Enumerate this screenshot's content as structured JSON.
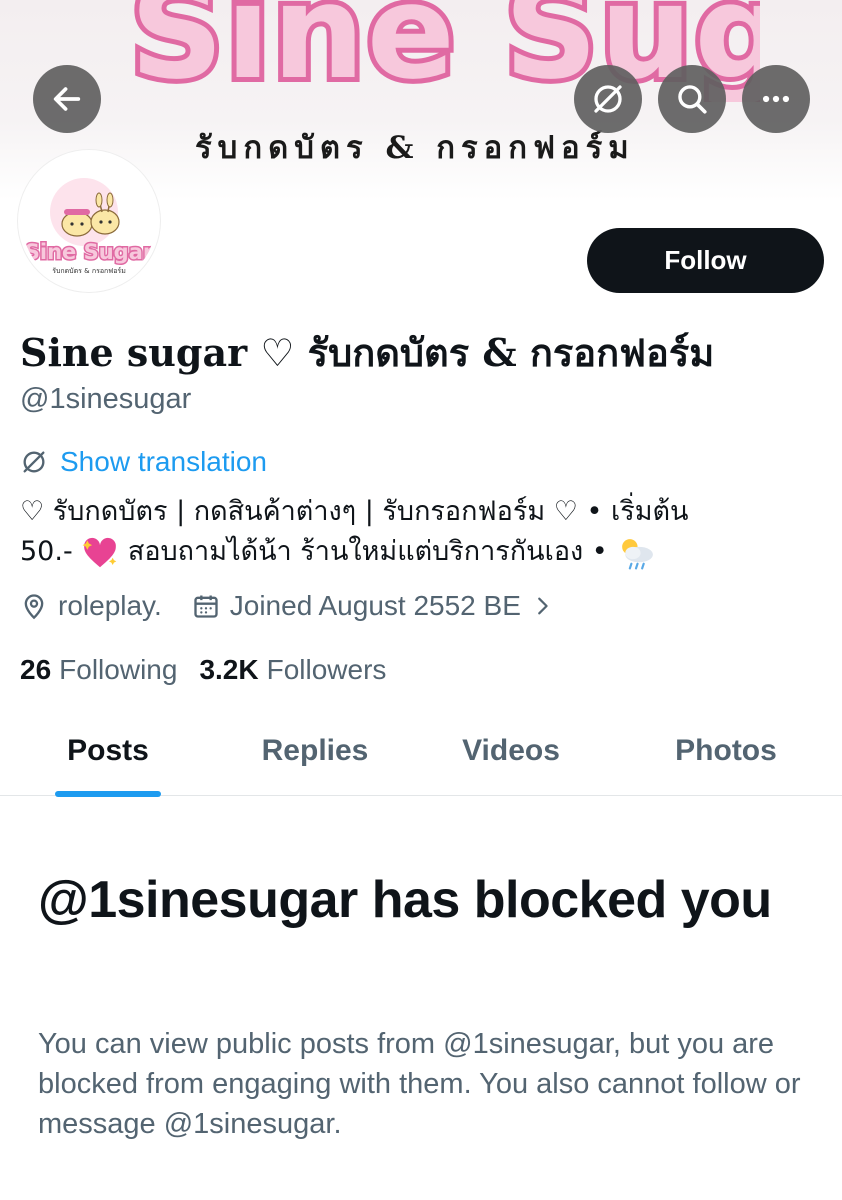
{
  "banner": {
    "logo_text": "Sine Sugar",
    "subtitle": "รับกดบัตร & กรอกฟอร์ม"
  },
  "avatar": {
    "logo_text": "Sine Sugar",
    "subtitle": "รับกดบัตร & กรอกฟอร์ม"
  },
  "nav": {
    "back_icon": "arrow-left-icon",
    "translate_icon": "translate-icon",
    "search_icon": "search-icon",
    "more_icon": "more-icon"
  },
  "profile": {
    "follow_label": "Follow",
    "display_name": "Sine sugar ♡ รับกดบัตร & กรอกฟอร์ม",
    "handle": "@1sinesugar",
    "show_translation": "Show translation",
    "bio_line1": "♡ รับกดบัตร | กดสินค้าต่างๆ | รับกรอกฟอร์ม ♡ • เริ่มต้น",
    "bio_line2_a": "50.- ",
    "bio_line2_b": " สอบถามได้น้า ร้านใหม่แต่บริการกันเอง • ",
    "location": "roleplay.",
    "joined": "Joined August 2552 BE",
    "following_count": "26",
    "following_label": "Following",
    "followers_count": "3.2K",
    "followers_label": "Followers"
  },
  "tabs": [
    {
      "label": "Posts",
      "active": true
    },
    {
      "label": "Replies",
      "active": false
    },
    {
      "label": "Videos",
      "active": false
    },
    {
      "label": "Photos",
      "active": false
    }
  ],
  "blocked": {
    "title": "@1sinesugar has blocked you",
    "description": "You can view public posts from @1sinesugar, but you are blocked from engaging with them. You also cannot follow or message @1sinesugar."
  },
  "colors": {
    "accent": "#1d9bf0",
    "text_primary": "#0f1419",
    "text_secondary": "#536471",
    "logo_pink": "#e06aa3"
  }
}
